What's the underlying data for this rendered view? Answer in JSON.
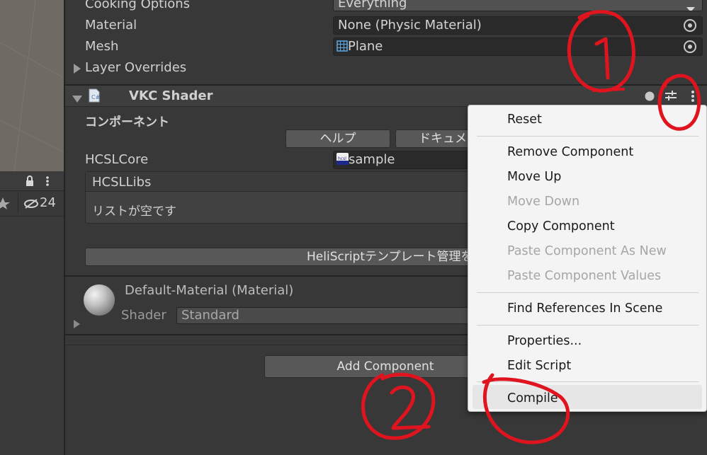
{
  "left_panel": {
    "visibility_count": "24"
  },
  "mesh_collider": {
    "cooking_options_label": "Cooking Options",
    "cooking_options_value": "Everything",
    "material_label": "Material",
    "material_value": "None (Physic Material)",
    "mesh_label": "Mesh",
    "mesh_value": "Plane",
    "layer_overrides_label": "Layer Overrides"
  },
  "vkc_shader": {
    "title": "VKC Shader",
    "component_label": "コンポーネント",
    "help_button": "ヘルプ",
    "docs_button": "ドキュメン",
    "hcsl_core_label": "HCSLCore",
    "hcsl_core_value": "sample",
    "hcsl_libs_label": "HCSLLibs",
    "list_empty": "リストが空です",
    "template_button": "HeliScriptテンプレート管理を開"
  },
  "material": {
    "name": "Default-Material (Material)",
    "shader_label": "Shader",
    "shader_value": "Standard"
  },
  "add_component_button": "Add Component",
  "context_menu": {
    "reset": "Reset",
    "remove_component": "Remove Component",
    "move_up": "Move Up",
    "move_down": "Move Down",
    "copy_component": "Copy Component",
    "paste_as_new": "Paste Component As New",
    "paste_values": "Paste Component Values",
    "find_references": "Find References In Scene",
    "properties": "Properties...",
    "edit_script": "Edit Script",
    "compile": "Compile"
  },
  "colors": {
    "annotation": "#e0141e",
    "menu_bg": "#f4f4f4",
    "panel_bg": "#383838"
  }
}
